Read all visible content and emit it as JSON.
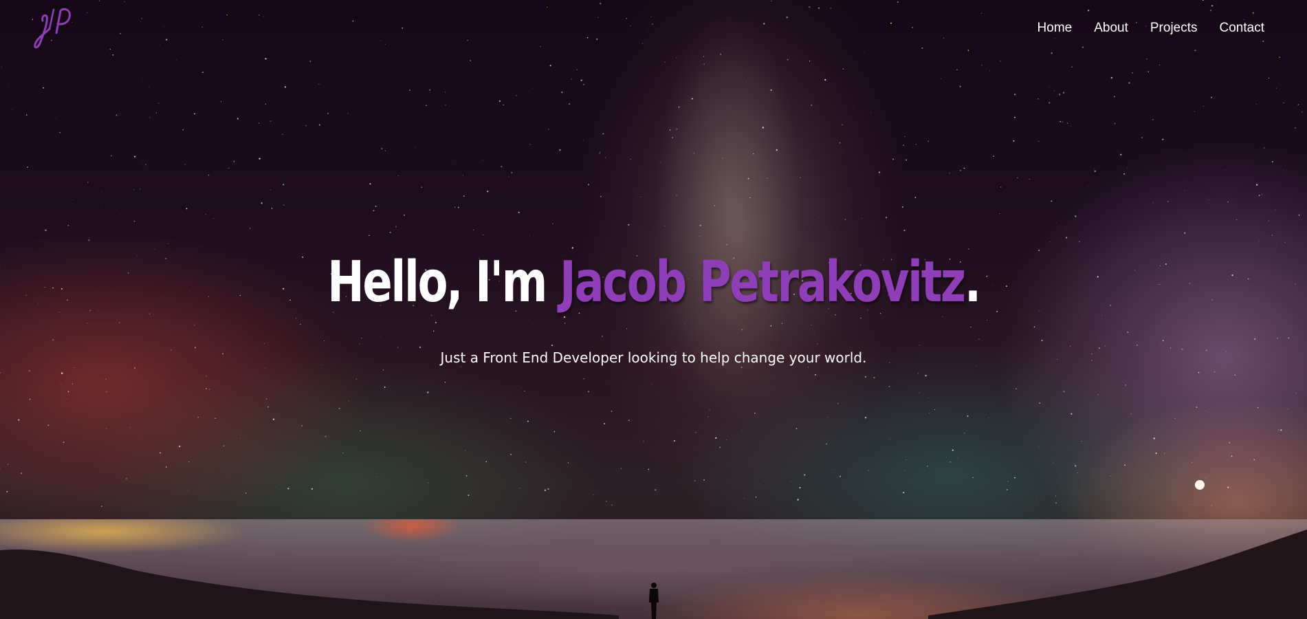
{
  "header": {
    "logo_icon": "jp-signature-logo-icon",
    "nav": [
      "Home",
      "About",
      "Projects",
      "Contact"
    ]
  },
  "hero": {
    "headline_prefix": "Hello, I'm ",
    "headline_name": "Jacob Petrakovitz",
    "headline_suffix": ".",
    "subtitle": "Just a Front End Developer looking to help change your world.",
    "background": "starry-night-sky-with-milky-way-over-clouds"
  },
  "colors": {
    "accent": "#8e3fb8",
    "text": "#ffffff"
  }
}
